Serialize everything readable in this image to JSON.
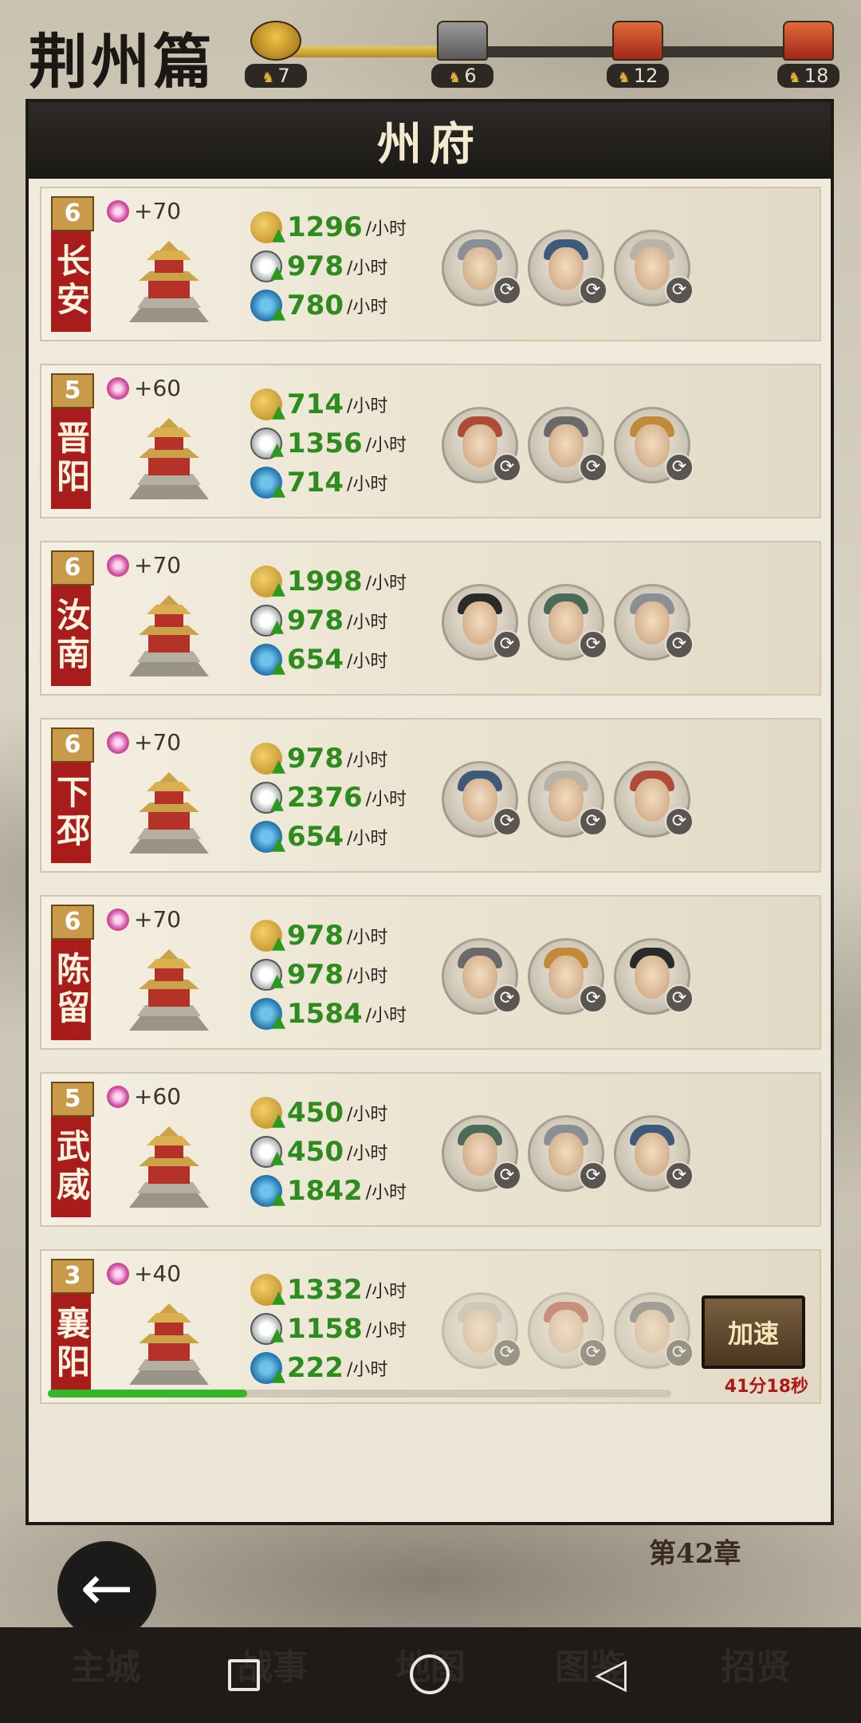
{
  "top_bar": {
    "chapter_title": "荆州篇",
    "progress_fraction": 0.36,
    "milestones": [
      {
        "requirement": "7",
        "type": "start"
      },
      {
        "requirement": "6",
        "type": "locked"
      },
      {
        "requirement": "12",
        "type": "open"
      },
      {
        "requirement": "18",
        "type": "open"
      }
    ]
  },
  "panel": {
    "title": "州府",
    "unit": "/小时",
    "cities": [
      {
        "level": "6",
        "name": "长安",
        "bonus": "+70",
        "grain": "1296",
        "coin": "978",
        "jade": "780",
        "heroes": [
          "hero-1",
          "hero-2",
          "hero-3"
        ]
      },
      {
        "level": "5",
        "name": "晋阳",
        "bonus": "+60",
        "grain": "714",
        "coin": "1356",
        "jade": "714",
        "heroes": [
          "hero-1",
          "hero-2",
          "hero-3"
        ]
      },
      {
        "level": "6",
        "name": "汝南",
        "bonus": "+70",
        "grain": "1998",
        "coin": "978",
        "jade": "654",
        "heroes": [
          "hero-1",
          "hero-2",
          "hero-3"
        ]
      },
      {
        "level": "6",
        "name": "下邳",
        "bonus": "+70",
        "grain": "978",
        "coin": "2376",
        "jade": "654",
        "heroes": [
          "hero-1",
          "hero-2",
          "hero-3"
        ]
      },
      {
        "level": "6",
        "name": "陈留",
        "bonus": "+70",
        "grain": "978",
        "coin": "978",
        "jade": "1584",
        "heroes": [
          "hero-1",
          "hero-2",
          "hero-3"
        ]
      },
      {
        "level": "5",
        "name": "武威",
        "bonus": "+60",
        "grain": "450",
        "coin": "450",
        "jade": "1842",
        "heroes": [
          "hero-1",
          "hero-2",
          "hero-3"
        ]
      },
      {
        "level": "3",
        "name": "襄阳",
        "bonus": "+40",
        "grain": "1332",
        "coin": "1158",
        "jade": "222",
        "heroes": [
          "hero-1",
          "hero-2",
          "hero-3"
        ],
        "upgrading": true,
        "speed_label": "加速",
        "countdown": "41分18秒",
        "build_progress": 0.32
      }
    ]
  },
  "chapter_badge": "第42章",
  "game_tabs": [
    "主城",
    "战事",
    "地图",
    "图鉴",
    "招贤"
  ],
  "colors": {
    "green_value": "#2e8b1e",
    "city_red": "#a81c1c",
    "countdown_red": "#b01818"
  }
}
